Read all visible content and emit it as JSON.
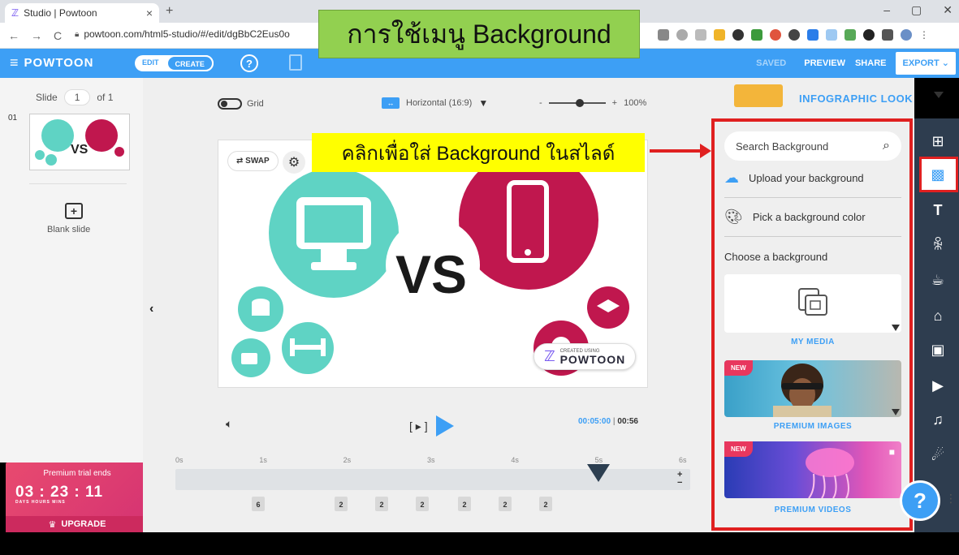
{
  "browser": {
    "tab_title": "Studio | Powtoon",
    "tab_close": "×",
    "new_tab": "+",
    "url": "powtoon.com/html5-studio/#/edit/dgBbC2Eus0o",
    "window_controls": [
      "–",
      "▢",
      "✕"
    ]
  },
  "overlay": {
    "title": "การใช้เมนู Background",
    "callout": "คลิกเพื่อใส่ Background ในสไลด์"
  },
  "header": {
    "logo": "POWTOON",
    "mode_edit": "EDIT",
    "mode_create": "CREATE",
    "help": "?",
    "saved": "SAVED",
    "preview": "PREVIEW",
    "share": "SHARE",
    "export": "EXPORT ⌄"
  },
  "slides_panel": {
    "slide_label": "Slide",
    "slide_number": "1",
    "of_label": "of 1",
    "thumb_index": "01",
    "blank_slide": "Blank slide",
    "blank_plus": "+"
  },
  "trial": {
    "label": "Premium trial ends",
    "countdown": "03 : 23 : 11",
    "units": "DAYS  HOURS  MINS",
    "upgrade": "UPGRADE"
  },
  "canvas_toolbar": {
    "grid": "Grid",
    "orientation": "Horizontal (16:9)",
    "zoom_minus": "-",
    "zoom_plus": "+",
    "zoom_level": "100%",
    "zoom_fraction": 0.55
  },
  "stage": {
    "swap": "SWAP",
    "vs": "VS",
    "created_using": "CREATED USING",
    "brand": "POWTOON"
  },
  "player": {
    "current_time": "00:05:00",
    "total_time": "00:56",
    "playhead_seconds": 5
  },
  "timeline": {
    "ticks": [
      "0s",
      "1s",
      "2s",
      "3s",
      "4s",
      "5s",
      "6s"
    ],
    "zoom_in": "+",
    "zoom_out": "−",
    "durations": [
      "6",
      "2",
      "2",
      "2",
      "2",
      "2",
      "2"
    ]
  },
  "background_panel": {
    "look": "INFOGRAPHIC LOOK",
    "search_placeholder": "Search Background",
    "upload": "Upload your background",
    "pick_color": "Pick a background color",
    "choose": "Choose a background",
    "my_media": "MY MEDIA",
    "premium_images": "PREMIUM IMAGES",
    "premium_videos": "PREMIUM VIDEOS",
    "new_badge": "NEW"
  },
  "help_fab": "?",
  "colors": {
    "brand_blue": "#3d9ff5",
    "teal": "#5fd3c4",
    "crimson": "#c0174e",
    "rail": "#2e3d4f",
    "highlight_red": "#e02020"
  }
}
